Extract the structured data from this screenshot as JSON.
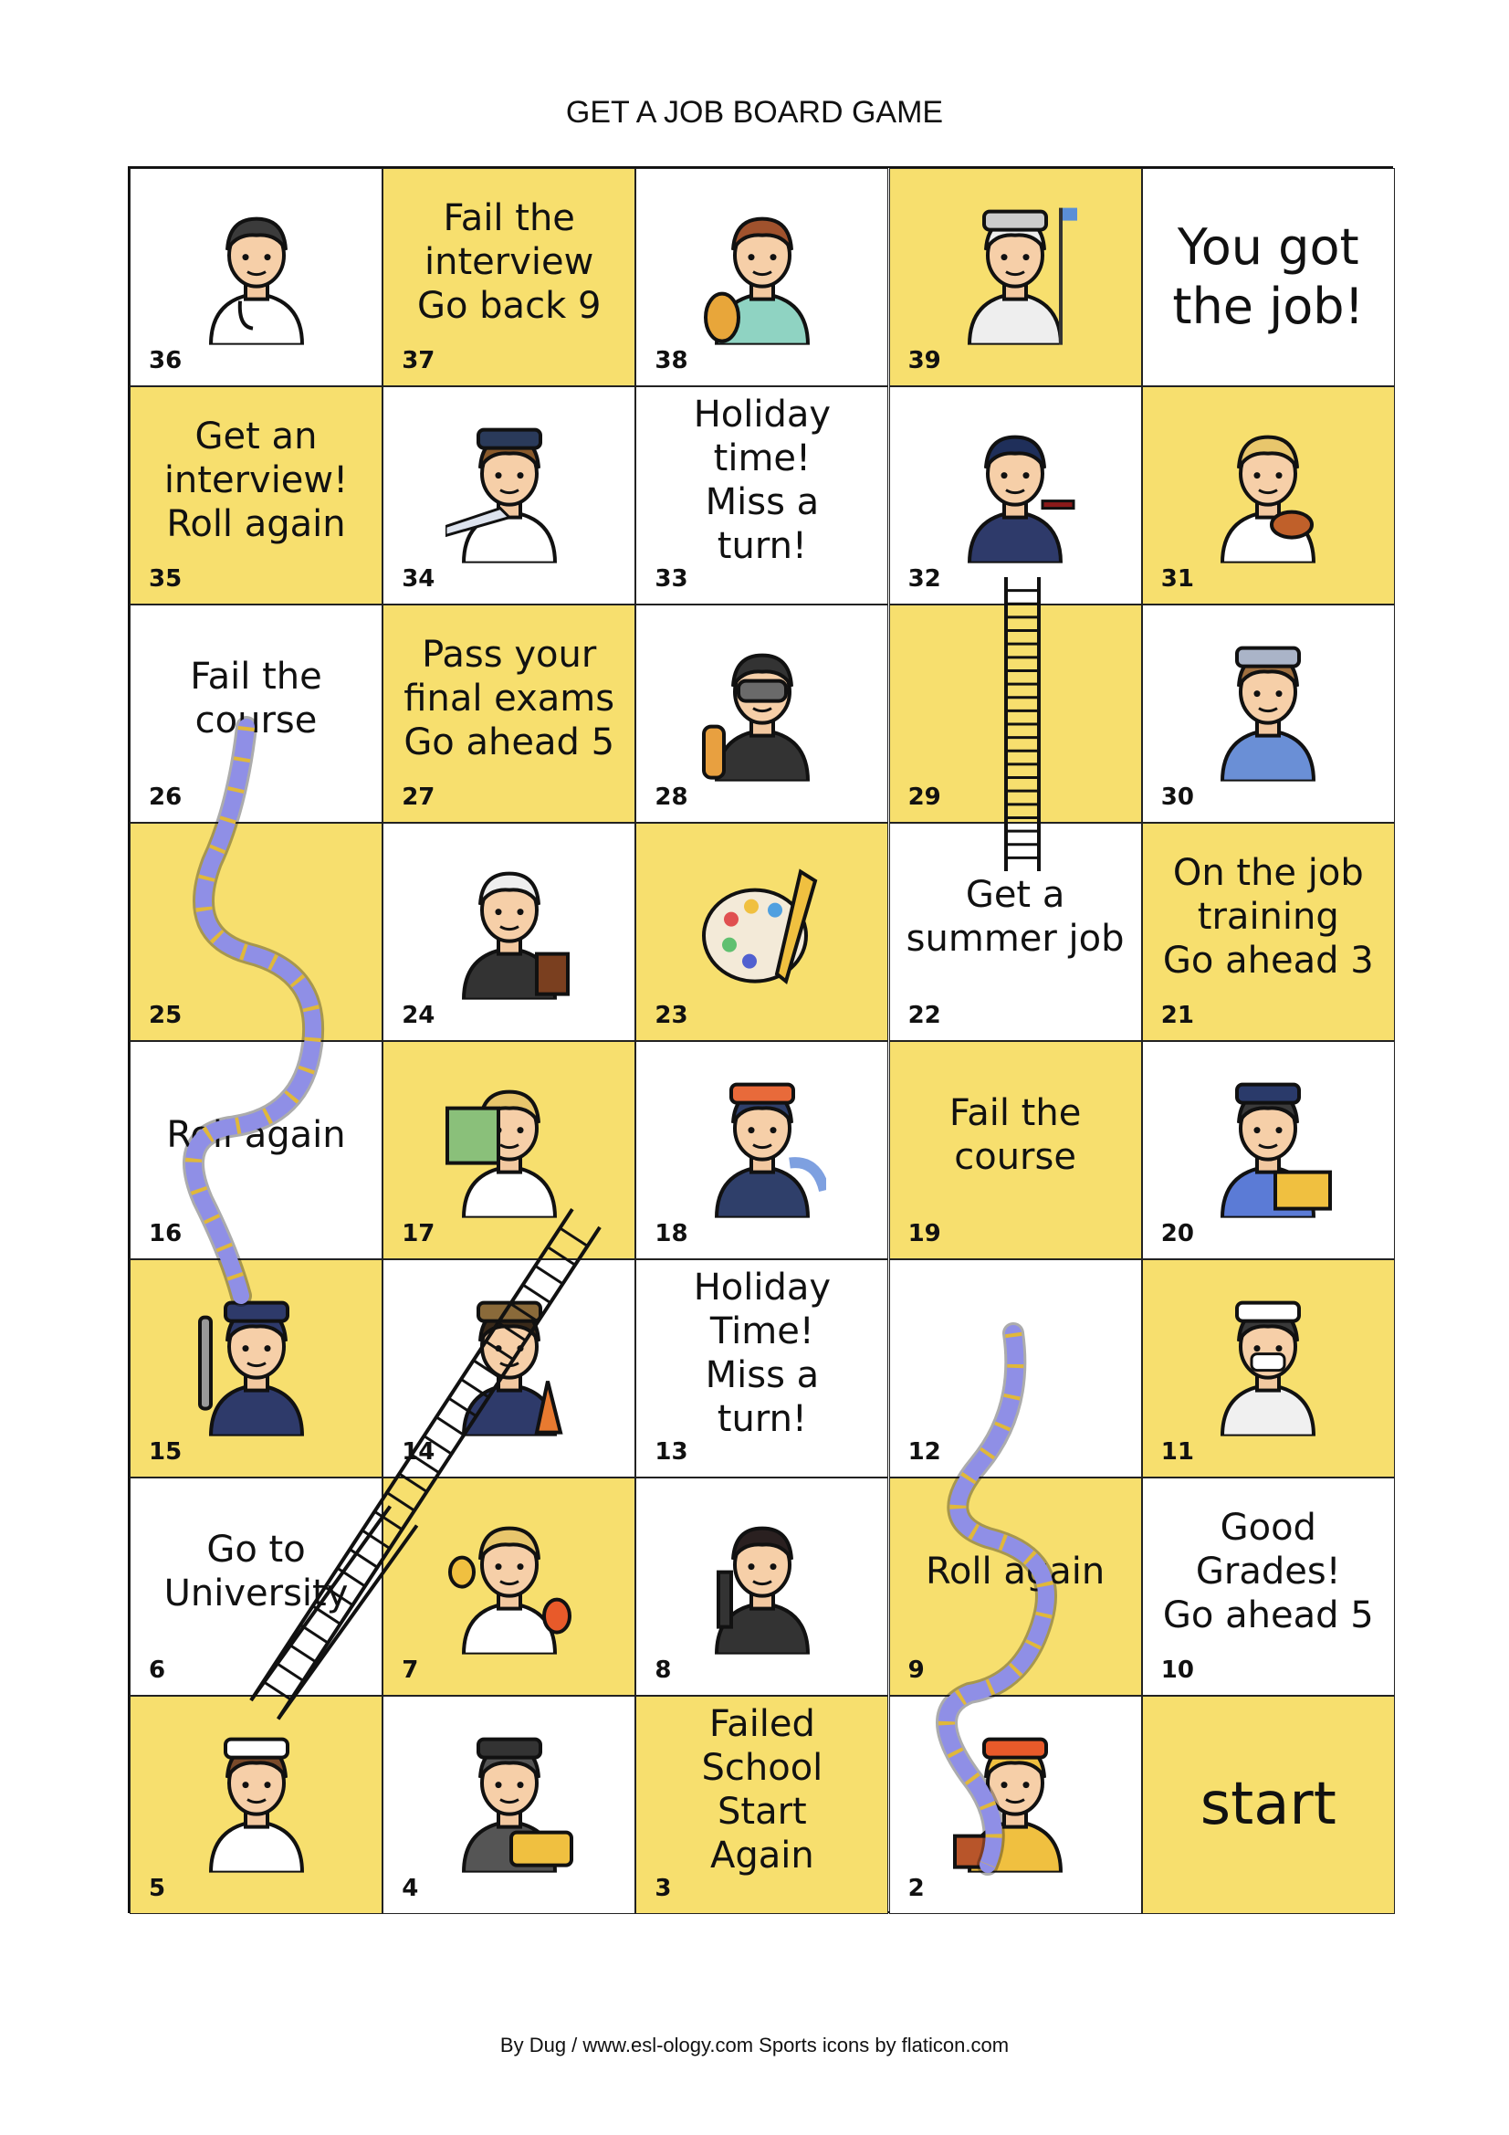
{
  "title": "GET A JOB BOARD GAME",
  "footer": "By Dug / www.esl-ology.com   Sports icons by flaticon.com",
  "colors": {
    "yellow": "#f7df6e",
    "white": "#ffffff",
    "snake": "#8f8fe6",
    "snake_stripe": "#e0b83a",
    "ladder": "#111111"
  },
  "cells": {
    "c1": {
      "number": "",
      "text": "start",
      "icon": ""
    },
    "c2": {
      "number": "2",
      "text": "",
      "icon": "bricklayer-icon"
    },
    "c3": {
      "number": "3",
      "text": "Failed\nSchool\nStart\nAgain",
      "icon": ""
    },
    "c4": {
      "number": "4",
      "text": "",
      "icon": "taxi-driver-icon"
    },
    "c5": {
      "number": "5",
      "text": "",
      "icon": "chef-icon"
    },
    "c6": {
      "number": "6",
      "text": "Go to\nUniversity",
      "icon": ""
    },
    "c7": {
      "number": "7",
      "text": "",
      "icon": "actor-icon"
    },
    "c8": {
      "number": "8",
      "text": "",
      "icon": "singer-icon"
    },
    "c9": {
      "number": "9",
      "text": "Roll again",
      "icon": ""
    },
    "c10": {
      "number": "10",
      "text": "Good\nGrades!\nGo ahead 5",
      "icon": ""
    },
    "c11": {
      "number": "11",
      "text": "",
      "icon": "nurse-icon"
    },
    "c12": {
      "number": "12",
      "text": "",
      "icon": ""
    },
    "c13": {
      "number": "13",
      "text": "Holiday\nTime!\nMiss a\nturn!",
      "icon": ""
    },
    "c14": {
      "number": "14",
      "text": "",
      "icon": "farmer-icon"
    },
    "c15": {
      "number": "15",
      "text": "",
      "icon": "mechanic-icon"
    },
    "c16": {
      "number": "16",
      "text": "Roll again",
      "icon": ""
    },
    "c17": {
      "number": "17",
      "text": "",
      "icon": "teacher-icon"
    },
    "c18": {
      "number": "18",
      "text": "",
      "icon": "firefighter-icon"
    },
    "c19": {
      "number": "19",
      "text": "Fail the\ncourse",
      "icon": ""
    },
    "c20": {
      "number": "20",
      "text": "",
      "icon": "postman-icon"
    },
    "c21": {
      "number": "21",
      "text": "On the job\ntraining\nGo ahead 3",
      "icon": ""
    },
    "c22": {
      "number": "22",
      "text": "Get a\nsummer job",
      "icon": ""
    },
    "c23": {
      "number": "23",
      "text": "",
      "icon": "painter-palette-icon"
    },
    "c24": {
      "number": "24",
      "text": "",
      "icon": "judge-icon"
    },
    "c25": {
      "number": "25",
      "text": "",
      "icon": ""
    },
    "c26": {
      "number": "26",
      "text": "Fail the\ncourse",
      "icon": ""
    },
    "c27": {
      "number": "27",
      "text": "Pass your\nfinal exams\nGo ahead 5",
      "icon": ""
    },
    "c28": {
      "number": "28",
      "text": "",
      "icon": "diver-icon"
    },
    "c29": {
      "number": "29",
      "text": "",
      "icon": ""
    },
    "c30": {
      "number": "30",
      "text": "",
      "icon": "officer-icon"
    },
    "c31": {
      "number": "31",
      "text": "",
      "icon": "violinist-icon"
    },
    "c32": {
      "number": "32",
      "text": "",
      "icon": "waiter-icon"
    },
    "c33": {
      "number": "33",
      "text": "Holiday\ntime!\nMiss a\nturn!",
      "icon": ""
    },
    "c34": {
      "number": "34",
      "text": "",
      "icon": "pilot-icon"
    },
    "c35": {
      "number": "35",
      "text": "Get an\ninterview!\nRoll again",
      "icon": ""
    },
    "c36": {
      "number": "36",
      "text": "",
      "icon": "doctor-icon"
    },
    "c37": {
      "number": "37",
      "text": "Fail the\ninterview\nGo back 9",
      "icon": ""
    },
    "c38": {
      "number": "38",
      "text": "",
      "icon": "vet-icon"
    },
    "c39": {
      "number": "39",
      "text": "",
      "icon": "astronaut-icon"
    },
    "c40": {
      "number": "",
      "text": "You got\nthe job!",
      "icon": ""
    }
  }
}
